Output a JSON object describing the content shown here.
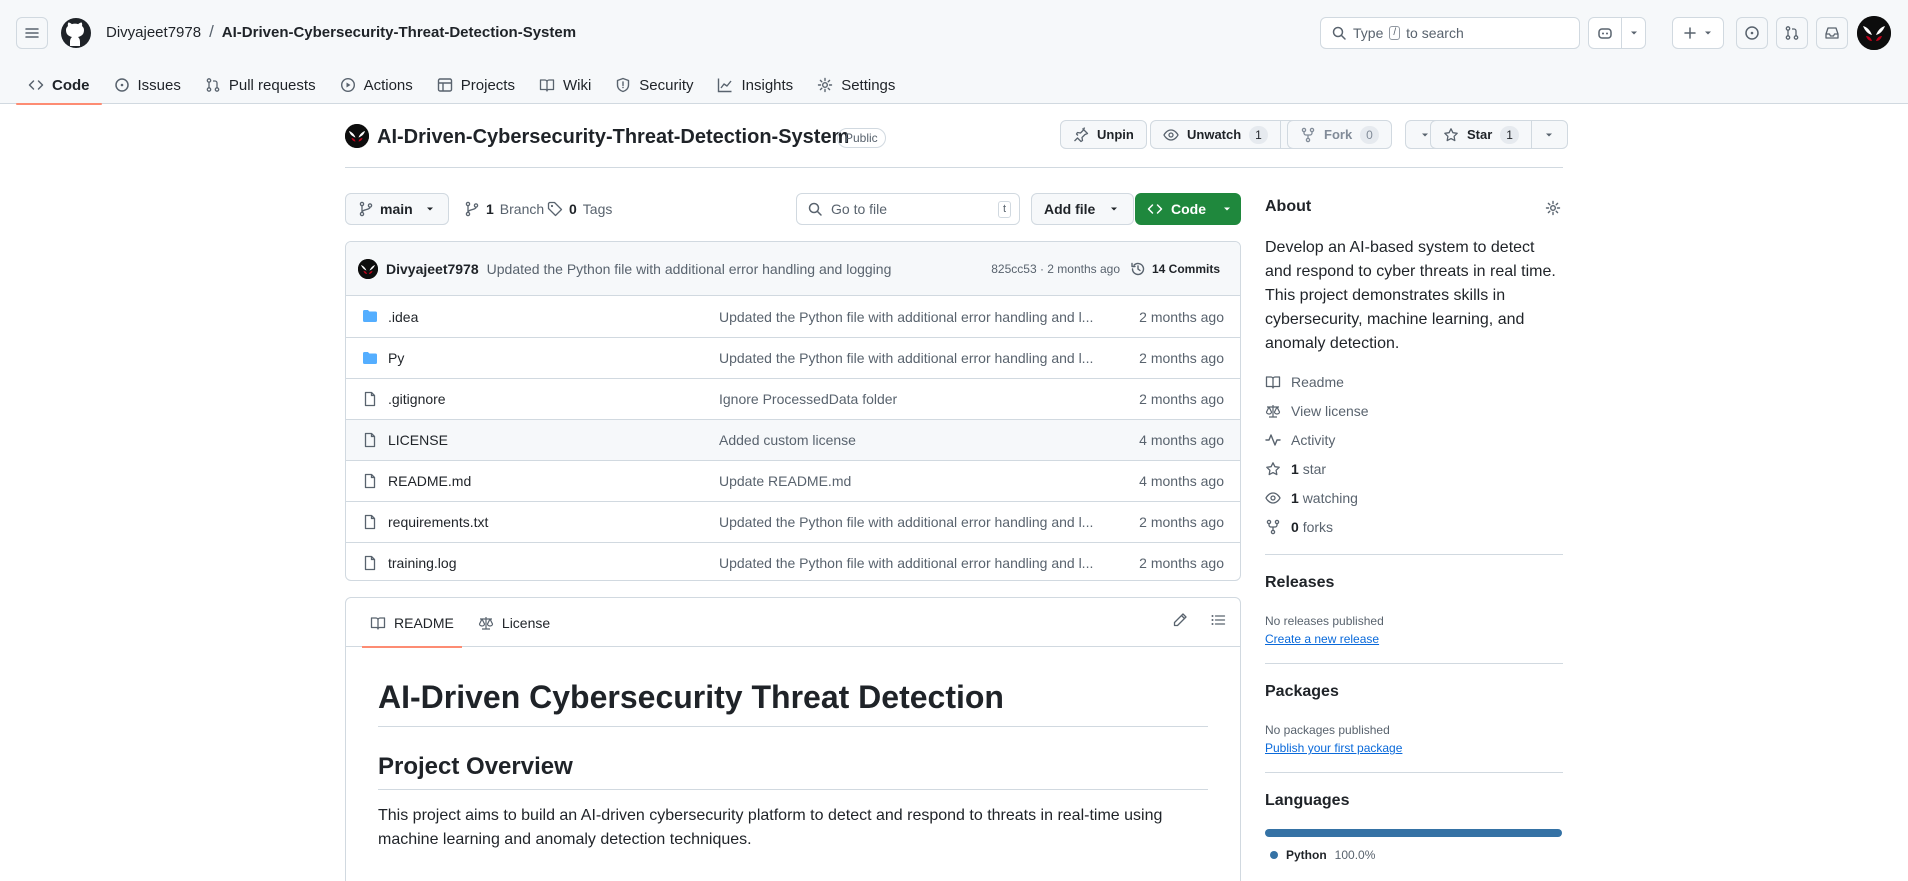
{
  "header": {
    "owner": "Divyajeet7978",
    "separator": "/",
    "repo": "AI-Driven-Cybersecurity-Threat-Detection-System",
    "search_prefix": "Type",
    "search_key": "/",
    "search_suffix": "to search"
  },
  "nav_tabs": [
    {
      "label": "Code",
      "icon": "code-icon"
    },
    {
      "label": "Issues",
      "icon": "issue-icon"
    },
    {
      "label": "Pull requests",
      "icon": "pull-request-icon"
    },
    {
      "label": "Actions",
      "icon": "play-icon"
    },
    {
      "label": "Projects",
      "icon": "table-icon"
    },
    {
      "label": "Wiki",
      "icon": "book-icon"
    },
    {
      "label": "Security",
      "icon": "shield-icon"
    },
    {
      "label": "Insights",
      "icon": "graph-icon"
    },
    {
      "label": "Settings",
      "icon": "gear-icon"
    }
  ],
  "repo_header": {
    "title": "AI-Driven-Cybersecurity-Threat-Detection-System",
    "visibility": "Public",
    "unpin": "Unpin",
    "unwatch": "Unwatch",
    "watch_count": "1",
    "fork": "Fork",
    "fork_count": "0",
    "star": "Star",
    "star_count": "1"
  },
  "toolbar": {
    "branch": "main",
    "branches_count": "1",
    "branches_label": "Branch",
    "tags_count": "0",
    "tags_label": "Tags",
    "goto_placeholder": "Go to file",
    "goto_key": "t",
    "add_file": "Add file",
    "code": "Code"
  },
  "latest_commit": {
    "author": "Divyajeet7978",
    "message": "Updated the Python file with additional error handling and logging",
    "meta": "825cc53 · 2 months ago",
    "commits": "14 Commits"
  },
  "files": [
    {
      "name": ".idea",
      "type": "folder",
      "message": "Updated the Python file with additional error handling and l...",
      "age": "2 months ago"
    },
    {
      "name": "Py",
      "type": "folder",
      "message": "Updated the Python file with additional error handling and l...",
      "age": "2 months ago"
    },
    {
      "name": ".gitignore",
      "type": "file",
      "message": "Ignore ProcessedData folder",
      "age": "2 months ago"
    },
    {
      "name": "LICENSE",
      "type": "file",
      "message": "Added custom license",
      "age": "4 months ago"
    },
    {
      "name": "README.md",
      "type": "file",
      "message": "Update README.md",
      "age": "4 months ago"
    },
    {
      "name": "requirements.txt",
      "type": "file",
      "message": "Updated the Python file with additional error handling and l...",
      "age": "2 months ago"
    },
    {
      "name": "training.log",
      "type": "file",
      "message": "Updated the Python file with additional error handling and l...",
      "age": "2 months ago"
    }
  ],
  "readme": {
    "tab_readme": "README",
    "tab_license": "License",
    "h1": "AI-Driven Cybersecurity Threat Detection",
    "h2": "Project Overview",
    "paragraph": "This project aims to build an AI-driven cybersecurity platform to detect and respond to threats in real-time using machine learning and anomaly detection techniques."
  },
  "sidebar": {
    "about_title": "About",
    "description": "Develop an AI-based system to detect and respond to cyber threats in real time. This project demonstrates skills in cybersecurity, machine learning, and anomaly detection.",
    "links": {
      "readme": "Readme",
      "license": "View license",
      "activity": "Activity",
      "stars_count": "1",
      "stars_label": "star",
      "watching_count": "1",
      "watching_label": "watching",
      "forks_count": "0",
      "forks_label": "forks"
    },
    "releases_title": "Releases",
    "releases_none": "No releases published",
    "releases_link": "Create a new release",
    "packages_title": "Packages",
    "packages_none": "No packages published",
    "packages_link": "Publish your first package",
    "languages_title": "Languages",
    "language_name": "Python",
    "language_pct": "100.0%",
    "language_share": 1.0,
    "language_color": "#3572A5"
  },
  "colors": {
    "accent_underline": "#fd8c73",
    "code_button": "#1f883d",
    "link": "#0969da",
    "folder": "#54aeff"
  }
}
